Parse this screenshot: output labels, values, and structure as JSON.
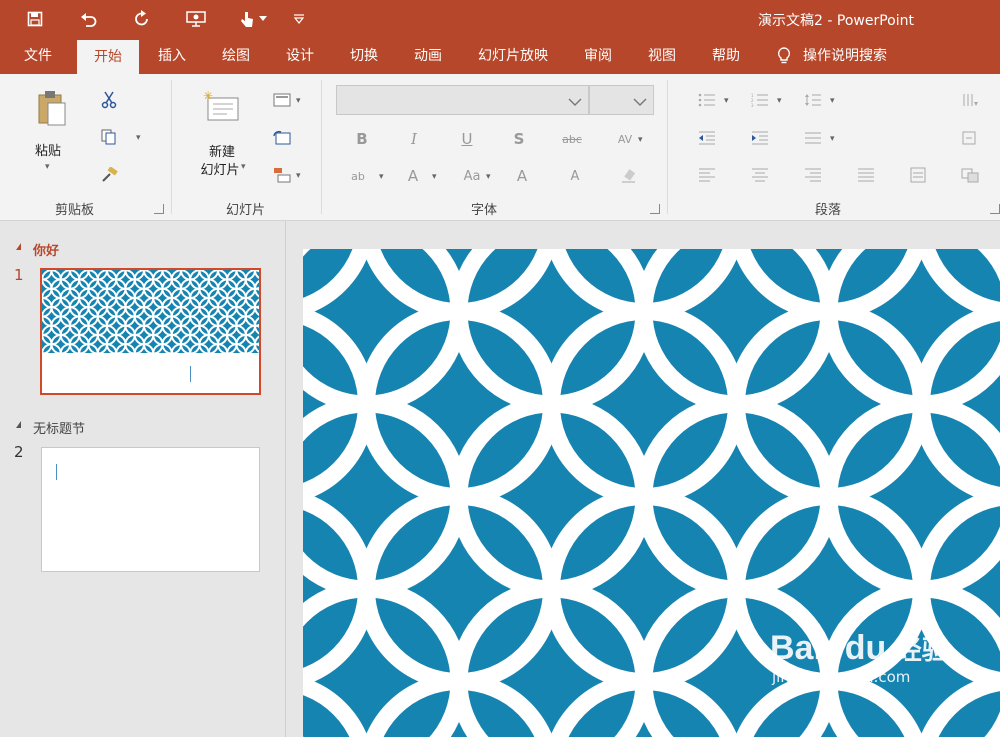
{
  "window": {
    "title": "演示文稿2  -  PowerPoint"
  },
  "quick_access": [
    {
      "name": "save-icon"
    },
    {
      "name": "undo-icon"
    },
    {
      "name": "redo-icon"
    },
    {
      "name": "present-from-start-icon"
    },
    {
      "name": "touch-mode-icon"
    },
    {
      "name": "customize-dropdown-icon"
    }
  ],
  "tabs": [
    {
      "label": "文件",
      "active": false
    },
    {
      "label": "开始",
      "active": true
    },
    {
      "label": "插入",
      "active": false
    },
    {
      "label": "绘图",
      "active": false
    },
    {
      "label": "设计",
      "active": false
    },
    {
      "label": "切换",
      "active": false
    },
    {
      "label": "动画",
      "active": false
    },
    {
      "label": "幻灯片放映",
      "active": false
    },
    {
      "label": "审阅",
      "active": false
    },
    {
      "label": "视图",
      "active": false
    },
    {
      "label": "帮助",
      "active": false
    }
  ],
  "tell_me": {
    "label": "操作说明搜索",
    "icon": "lightbulb-icon"
  },
  "ribbon": {
    "clipboard": {
      "label": "剪贴板",
      "paste_label": "粘贴"
    },
    "slides": {
      "label": "幻灯片",
      "new_slide_line1": "新建",
      "new_slide_line2": "幻灯片"
    },
    "font": {
      "label": "字体",
      "font_name": "",
      "font_size": ""
    },
    "paragraph": {
      "label": "段落"
    }
  },
  "slide_pane": {
    "sections": [
      {
        "title": "你好",
        "slides": [
          {
            "number": "1",
            "selected": true
          }
        ]
      },
      {
        "title": "无标题节",
        "slides": [
          {
            "number": "2",
            "selected": false
          }
        ]
      }
    ]
  },
  "colors": {
    "accent": "#b7472a",
    "slide_bg": "#1684b0",
    "pattern": "#ffffff"
  },
  "watermark": {
    "brand": "Bai",
    "brand2": "du",
    "cn": "经验",
    "url": "jingyan.baidu.com"
  }
}
